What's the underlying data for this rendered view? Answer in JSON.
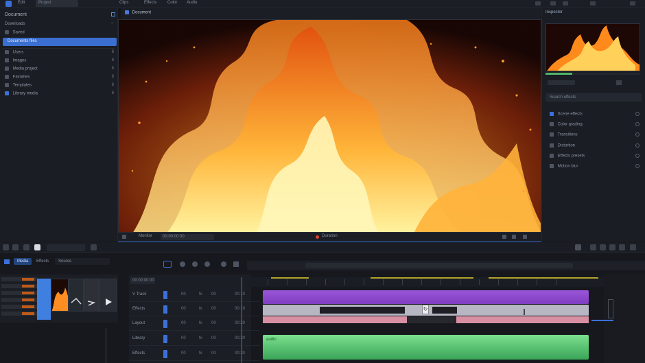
{
  "topbar": {
    "menu_1": "Edit",
    "project": "Project",
    "menu_2": "Clips",
    "menu_3": "Effects",
    "menu_4": "Color",
    "menu_5": "Audio"
  },
  "left_panel": {
    "title": "Document",
    "items": [
      {
        "label": "Downloads",
        "right": "⌃"
      },
      {
        "label": "Saved",
        "right": ""
      },
      {
        "label": "Documents files",
        "right": ""
      },
      {
        "label": "Users",
        "right": "8"
      },
      {
        "label": "Images",
        "right": "8"
      },
      {
        "label": "Media project",
        "right": "8"
      },
      {
        "label": "Favorites",
        "right": "8"
      },
      {
        "label": "Templates",
        "right": "8"
      },
      {
        "label": "Library media",
        "right": "8"
      }
    ]
  },
  "viewer": {
    "tab_label": "Document",
    "footer_left": "Monitor",
    "footer_mid": "00:00:00:00",
    "footer_center": "Duration"
  },
  "right_panel": {
    "title": "Inspector",
    "input": "Search effects",
    "items": [
      "Scene effects",
      "Color grading",
      "Transitions",
      "Distortion",
      "Effects presets",
      "Motion blur",
      "Source audio"
    ]
  },
  "bottom": {
    "tabs": [
      "Media",
      "Effects",
      "Source"
    ],
    "timecode": "00:00:00:00",
    "tracks": [
      {
        "name": "V Track",
        "v1": "00",
        "v2": "fx",
        "v3": "00",
        "v4": "00:10"
      },
      {
        "name": "Effects",
        "v1": "00",
        "v2": "fx",
        "v3": "00",
        "v4": "00:10"
      },
      {
        "name": "Layout",
        "v1": "00",
        "v2": "fx",
        "v3": "00",
        "v4": "00:20"
      },
      {
        "name": "Library",
        "v1": "00",
        "v2": "fx",
        "v3": "00",
        "v4": "00:30"
      },
      {
        "name": "Effects",
        "v1": "00",
        "v2": "fx",
        "v3": "00",
        "v4": "00:30"
      }
    ],
    "audio_clip_label": "audio"
  },
  "colors": {
    "accent": "#3b6fd1",
    "clip_purple": "#8e48cc",
    "clip_green": "#5cc878",
    "clip_pink": "#d88fa2"
  }
}
